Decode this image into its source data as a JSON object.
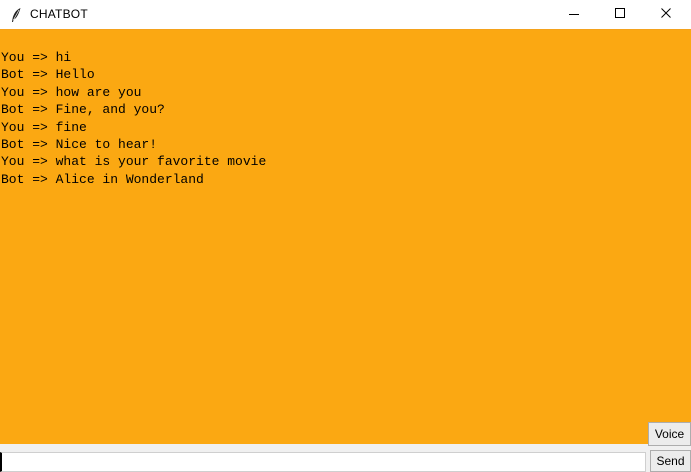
{
  "window": {
    "title": "CHATBOT",
    "controls": {
      "minimize_glyph": "–",
      "maximize_glyph": "☐",
      "close_glyph": "✕"
    }
  },
  "chat": {
    "background_color": "#fba812",
    "lines": [
      "You => hi",
      "Bot => Hello",
      "You => how are you",
      "Bot => Fine, and you?",
      "You => fine",
      "Bot => Nice to hear!",
      "You => what is your favorite movie",
      "Bot => Alice in Wonderland"
    ]
  },
  "input": {
    "value": "",
    "placeholder": ""
  },
  "buttons": {
    "voice_label": "Voice",
    "send_label": "Send"
  },
  "icons": {
    "app_icon": "feather-icon",
    "minimize": "minimize-icon",
    "maximize": "maximize-icon",
    "close": "close-icon"
  }
}
